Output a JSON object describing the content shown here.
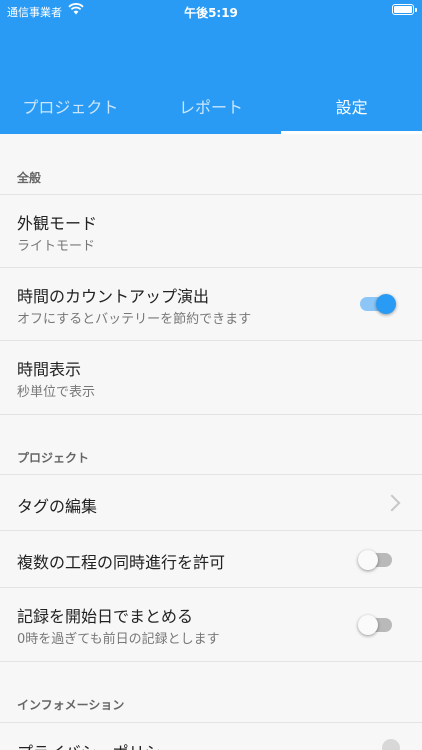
{
  "status_bar": {
    "carrier": "通信事業者",
    "time": "午後5:19"
  },
  "tabs": [
    {
      "label": "プロジェクト"
    },
    {
      "label": "レポート"
    },
    {
      "label": "設定"
    }
  ],
  "sections": {
    "general": "全般",
    "project": "プロジェクト",
    "info": "インフォメーション"
  },
  "rows": {
    "appearance": {
      "title": "外観モード",
      "subtitle": "ライトモード"
    },
    "countup": {
      "title": "時間のカウントアップ演出",
      "subtitle": "オフにするとバッテリーを節約できます",
      "enabled": true
    },
    "time_display": {
      "title": "時間表示",
      "subtitle": "秒単位で表示"
    },
    "tag_edit": {
      "title": "タグの編集"
    },
    "parallel": {
      "title": "複数の工程の同時進行を許可",
      "enabled": false
    },
    "start_date": {
      "title": "記録を開始日でまとめる",
      "subtitle": "0時を過ぎても前日の記録とします",
      "enabled": false
    },
    "privacy": {
      "title": "プライバシーポリシー"
    }
  },
  "colors": {
    "accent": "#2a9bf4"
  }
}
